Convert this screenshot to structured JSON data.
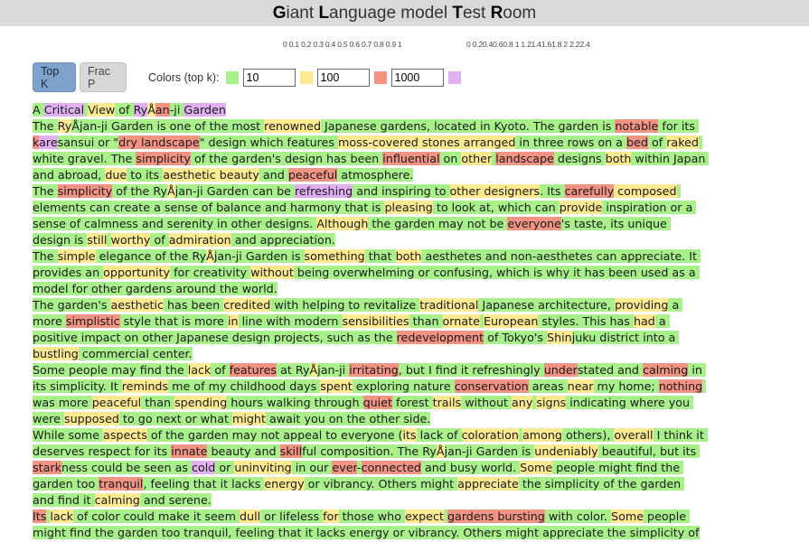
{
  "title_parts": [
    {
      "b": "G",
      "t": "iant "
    },
    {
      "b": "L",
      "t": "anguage model "
    },
    {
      "b": "T",
      "t": "est "
    },
    {
      "b": "R",
      "t": "oom"
    }
  ],
  "hist_frac_labels": "0  0.1 0.2 0.3 0.4 0.5 0.6 0.7 0.8 0.9  1",
  "hist_entropy_labels": "0 0.20.40.60.8  1  1.21.41.61.8  2 2.22.4",
  "controls": {
    "top_k_label": "Top K",
    "frac_p_label": "Frac P",
    "colors_label": "Colors (top k):",
    "k1": "10",
    "k2": "100",
    "k3": "1000"
  },
  "colors": {
    "green": "#a7f08a",
    "yellow": "#fde98f",
    "red": "#f29384",
    "purple": "#e0b0f2",
    "active_button": "#7ea2cc"
  },
  "paragraphs": [
    [
      [
        "A ",
        "g"
      ],
      [
        "Critical",
        "p"
      ],
      [
        " ",
        "g"
      ],
      [
        "View",
        "y"
      ],
      [
        " of ",
        "g"
      ],
      [
        "Ry",
        "p"
      ],
      [
        "Å",
        "y"
      ],
      [
        "an",
        "r"
      ],
      [
        "-ji ",
        "g"
      ],
      [
        "Garden",
        "p"
      ]
    ],
    [
      [
        "The ",
        "g"
      ],
      [
        "Ry",
        "y"
      ],
      [
        "Åjan-ji Garden is one of the most ",
        "g"
      ],
      [
        "renowned",
        "y"
      ],
      [
        " Japanese gardens, located in Kyoto. The garden is ",
        "g"
      ],
      [
        "notable",
        "r"
      ],
      [
        " for its ",
        "g"
      ],
      [
        "k",
        "r"
      ],
      [
        "are",
        "p"
      ],
      [
        "sansui or \"",
        "g"
      ],
      [
        "dry landscape",
        "r"
      ],
      [
        "\" design which features ",
        "g"
      ],
      [
        "moss-covered",
        "y"
      ],
      [
        " stones ",
        "y"
      ],
      [
        "arranged",
        "y"
      ],
      [
        " in three rows on a ",
        "g"
      ],
      [
        "bed",
        "r"
      ],
      [
        " of ",
        "g"
      ],
      [
        "raked",
        "y"
      ],
      [
        " white gravel. The ",
        "g"
      ],
      [
        "simplicity",
        "r"
      ],
      [
        " of the garden's design has been ",
        "g"
      ],
      [
        "influential",
        "r"
      ],
      [
        " on ",
        "g"
      ],
      [
        "other",
        "y"
      ],
      [
        " ",
        "g"
      ],
      [
        "landscape",
        "r"
      ],
      [
        " designs ",
        "g"
      ],
      [
        "both",
        "y"
      ],
      [
        " within Japan and abroad, ",
        "g"
      ],
      [
        "due",
        "y"
      ],
      [
        " to its ",
        "g"
      ],
      [
        "aesthetic beauty",
        "y"
      ],
      [
        " and ",
        "g"
      ],
      [
        "peaceful",
        "r"
      ],
      [
        " atmosphere.",
        "g"
      ]
    ],
    [
      [
        "The ",
        "g"
      ],
      [
        "simplicity",
        "r"
      ],
      [
        " of the Ry",
        "g"
      ],
      [
        "Å",
        "y"
      ],
      [
        "jan-ji Garden can be ",
        "g"
      ],
      [
        "refreshing",
        "p"
      ],
      [
        " and inspiring to ",
        "g"
      ],
      [
        "other designers",
        "y"
      ],
      [
        ". Its ",
        "g"
      ],
      [
        "carefully",
        "r"
      ],
      [
        " composed",
        "y"
      ],
      [
        " elements can create a sense of balance and harmony that is ",
        "g"
      ],
      [
        "pleasing",
        "y"
      ],
      [
        " to look at, which can ",
        "g"
      ],
      [
        "provide",
        "y"
      ],
      [
        " inspiration or a sense of calmness and serenity in other designs. ",
        "g"
      ],
      [
        "Although",
        "y"
      ],
      [
        " the garden may not be ",
        "g"
      ],
      [
        "everyone",
        "r"
      ],
      [
        "'s taste, its unique design is ",
        "g"
      ],
      [
        "still",
        "y"
      ],
      [
        " ",
        "g"
      ],
      [
        "worthy",
        "y"
      ],
      [
        " of ",
        "g"
      ],
      [
        "admiration",
        "y"
      ],
      [
        " and appreciation.",
        "g"
      ]
    ],
    [
      [
        "The ",
        "g"
      ],
      [
        "simple",
        "y"
      ],
      [
        " elegance of the Ry",
        "g"
      ],
      [
        "Å",
        "y"
      ],
      [
        "jan-ji Garden is ",
        "g"
      ],
      [
        "something",
        "y"
      ],
      [
        " that ",
        "g"
      ],
      [
        "both",
        "y"
      ],
      [
        " aesthetes and non-aesthetes can appreciate. It provides an ",
        "g"
      ],
      [
        "opportunity",
        "y"
      ],
      [
        " for creativity ",
        "g"
      ],
      [
        "without",
        "y"
      ],
      [
        " being overwhelming or confusing, which is why it has been used as a model for other gardens around the world.",
        "g"
      ]
    ],
    [
      [
        "The garden's ",
        "g"
      ],
      [
        "aesthetic",
        "y"
      ],
      [
        " has been ",
        "g"
      ],
      [
        "credited",
        "y"
      ],
      [
        " with helping to revitalize ",
        "g"
      ],
      [
        "traditional",
        "y"
      ],
      [
        " Japanese architecture, ",
        "g"
      ],
      [
        "providing",
        "y"
      ],
      [
        " a more ",
        "g"
      ],
      [
        "simplistic",
        "r"
      ],
      [
        " style that is more ",
        "g"
      ],
      [
        "in",
        "y"
      ],
      [
        " line with modern ",
        "g"
      ],
      [
        "sensibilities",
        "y"
      ],
      [
        " than ",
        "g"
      ],
      [
        "ornate",
        "y"
      ],
      [
        " ",
        "g"
      ],
      [
        "European",
        "y"
      ],
      [
        " styles. This has ",
        "g"
      ],
      [
        "had",
        "y"
      ],
      [
        " a positive impact on other Japanese design projects, such as the ",
        "g"
      ],
      [
        "redevelopment",
        "r"
      ],
      [
        " of Tokyo's ",
        "g"
      ],
      [
        "Shin",
        "y"
      ],
      [
        "juku district into a ",
        "g"
      ],
      [
        "bustling",
        "y"
      ],
      [
        " commercial center.",
        "g"
      ]
    ],
    [
      [
        "Some people may find the ",
        "g"
      ],
      [
        "lack",
        "y"
      ],
      [
        " of ",
        "g"
      ],
      [
        "features",
        "r"
      ],
      [
        " at Ry",
        "g"
      ],
      [
        "Å",
        "y"
      ],
      [
        "jan-ji ",
        "g"
      ],
      [
        "irritating",
        "r"
      ],
      [
        ", but I find it refreshingly ",
        "g"
      ],
      [
        "under",
        "r"
      ],
      [
        "stated and ",
        "g"
      ],
      [
        "calming",
        "r"
      ],
      [
        " in its simplicity. It ",
        "g"
      ],
      [
        "reminds",
        "y"
      ],
      [
        " me of my childhood days ",
        "g"
      ],
      [
        "spent",
        "y"
      ],
      [
        " exploring nature ",
        "g"
      ],
      [
        "conservation",
        "r"
      ],
      [
        " areas ",
        "g"
      ],
      [
        "near",
        "y"
      ],
      [
        " my home; ",
        "g"
      ],
      [
        "nothing",
        "r"
      ],
      [
        " was more ",
        "g"
      ],
      [
        "peaceful",
        "y"
      ],
      [
        " than ",
        "g"
      ],
      [
        "spending",
        "y"
      ],
      [
        " hours walking through ",
        "g"
      ],
      [
        "quiet",
        "r"
      ],
      [
        " forest ",
        "g"
      ],
      [
        "trails",
        "y"
      ],
      [
        " without ",
        "g"
      ],
      [
        "any",
        "y"
      ],
      [
        " ",
        "g"
      ],
      [
        "signs",
        "y"
      ],
      [
        " indicating where you were ",
        "g"
      ],
      [
        "supposed",
        "y"
      ],
      [
        " to go next or what ",
        "g"
      ],
      [
        "might",
        "y"
      ],
      [
        " await you on the other side.",
        "g"
      ]
    ],
    [
      [
        "While some ",
        "g"
      ],
      [
        "aspects",
        "y"
      ],
      [
        " of the garden may not appeal to everyone (",
        "g"
      ],
      [
        "its",
        "y"
      ],
      [
        " lack of ",
        "g"
      ],
      [
        "coloration",
        "y"
      ],
      [
        " ",
        "g"
      ],
      [
        "among",
        "y"
      ],
      [
        " others), ",
        "g"
      ],
      [
        "overall",
        "y"
      ],
      [
        " I think it deserves respect for its ",
        "g"
      ],
      [
        "innate",
        "r"
      ],
      [
        " beauty and ",
        "g"
      ],
      [
        "skill",
        "r"
      ],
      [
        "ful composition. The Ry",
        "g"
      ],
      [
        "Å",
        "y"
      ],
      [
        "jan-ji Garden is ",
        "g"
      ],
      [
        "undeniably",
        "y"
      ],
      [
        " beautiful, but its ",
        "g"
      ],
      [
        "stark",
        "r"
      ],
      [
        "ness could be seen as ",
        "g"
      ],
      [
        "cold",
        "p"
      ],
      [
        " or ",
        "g"
      ],
      [
        "uninviting",
        "y"
      ],
      [
        " in our ",
        "g"
      ],
      [
        "ever",
        "r"
      ],
      [
        "-",
        "g"
      ],
      [
        "connected",
        "r"
      ],
      [
        " and busy world. ",
        "g"
      ],
      [
        "Some",
        "y"
      ],
      [
        " people might find the garden too ",
        "g"
      ],
      [
        "tranquil",
        "r"
      ],
      [
        ", feeling that it lacks ",
        "g"
      ],
      [
        "energy",
        "y"
      ],
      [
        " or vibrancy. Others might ",
        "g"
      ],
      [
        "appreciate",
        "y"
      ],
      [
        " the simplicity of the garden and find it ",
        "g"
      ],
      [
        "calming",
        "y"
      ],
      [
        " and serene.",
        "g"
      ]
    ],
    [
      [
        "Its",
        "r"
      ],
      [
        " ",
        "g"
      ],
      [
        "lack",
        "y"
      ],
      [
        " of color could make it seem ",
        "g"
      ],
      [
        "dull",
        "y"
      ],
      [
        " or lifeless ",
        "g"
      ],
      [
        "for",
        "y"
      ],
      [
        " those who ",
        "g"
      ],
      [
        "expect",
        "y"
      ],
      [
        " ",
        "g"
      ],
      [
        "gardens bursting",
        "r"
      ],
      [
        " with color. ",
        "g"
      ],
      [
        "Some",
        "y"
      ],
      [
        " people might find the garden too tranquil, feeling that it lacks energy or vibrancy. Others might appreciate the simplicity of",
        "g"
      ]
    ]
  ]
}
